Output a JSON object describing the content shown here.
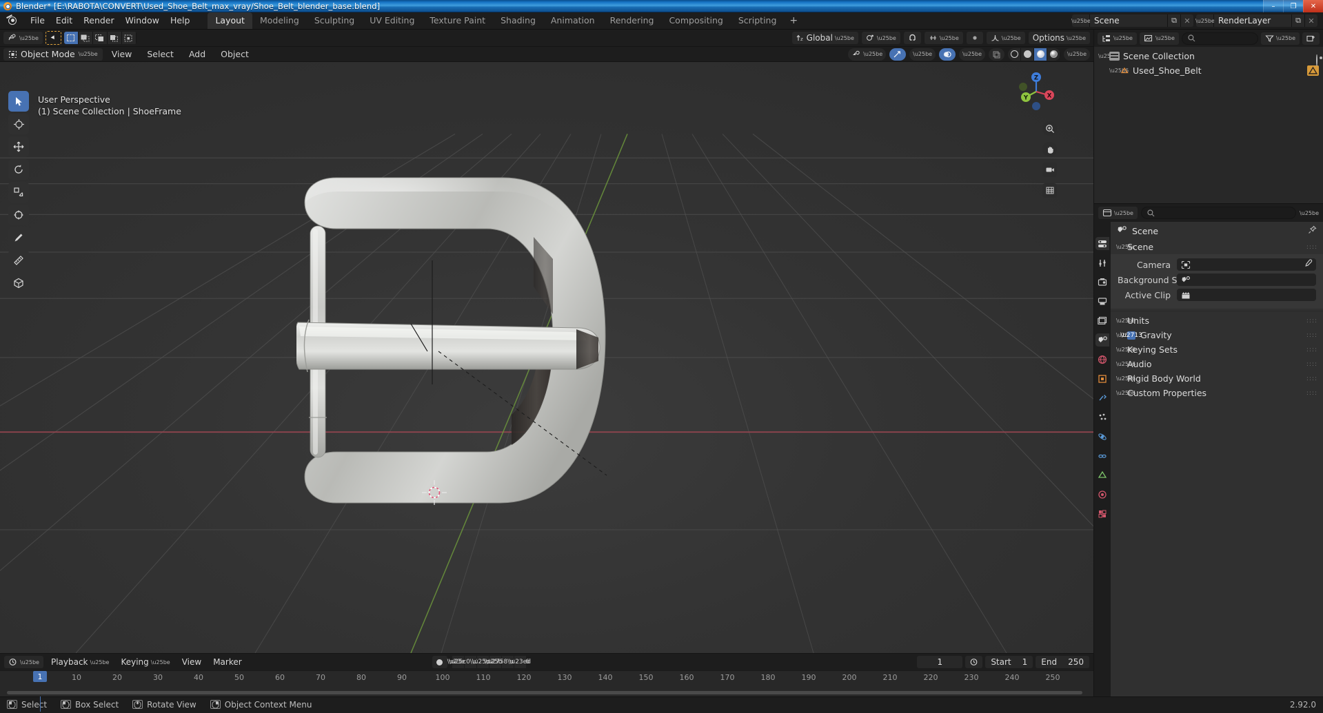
{
  "window": {
    "title": "Blender* [E:\\RABOTA\\CONVERT\\Used_Shoe_Belt_max_vray/Shoe_Belt_blender_base.blend]",
    "minimize": "–",
    "maximize": "❐",
    "close": "✕"
  },
  "topbar": {
    "menus": [
      "File",
      "Edit",
      "Render",
      "Window",
      "Help"
    ],
    "workspaces": [
      {
        "label": "Layout",
        "active": true
      },
      {
        "label": "Modeling",
        "active": false
      },
      {
        "label": "Sculpting",
        "active": false
      },
      {
        "label": "UV Editing",
        "active": false
      },
      {
        "label": "Texture Paint",
        "active": false
      },
      {
        "label": "Shading",
        "active": false
      },
      {
        "label": "Animation",
        "active": false
      },
      {
        "label": "Rendering",
        "active": false
      },
      {
        "label": "Compositing",
        "active": false
      },
      {
        "label": "Scripting",
        "active": false
      }
    ],
    "add_workspace": "+",
    "scene": {
      "name": "Scene",
      "dupe": "⧉",
      "unlink": "✕"
    },
    "view_layer": {
      "name": "RenderLayer",
      "dupe": "⧉",
      "unlink": "✕"
    }
  },
  "tool_header": {
    "editor_type": "editor-type-icon",
    "transform_orientation": "Global",
    "snap_label": "snap-magnet-icon",
    "proportional": "proportional-edit-icon",
    "options_label": "Options"
  },
  "viewport_header": {
    "mode": "Object Mode",
    "menus": [
      "View",
      "Select",
      "Add",
      "Object"
    ],
    "overlay_visibility": "show-hide-icon",
    "gizmo": "gizmo-icon",
    "overlays": "overlays-icon",
    "xray": "xray-icon",
    "shading_modes": [
      "wireframe",
      "solid",
      "material-preview",
      "rendered"
    ],
    "active_shading_index": 2
  },
  "viewport": {
    "perspective_label": "User Perspective",
    "collection_label": "(1) Scene Collection | ShoeFrame",
    "gizmo_axes": [
      {
        "name": "Z",
        "color": "#3e7ddb",
        "label": "Z"
      },
      {
        "name": "Y",
        "color": "#8fc33f",
        "label": "Y"
      },
      {
        "name": "X",
        "color": "#d9465a",
        "label": "X"
      }
    ],
    "nav_buttons": [
      "zoom-icon",
      "pan-hand-icon",
      "camera-icon",
      "ortho-persp-icon"
    ],
    "tools": [
      "tweak-select-tool",
      "cursor-tool",
      "move-tool",
      "rotate-tool",
      "scale-tool",
      "transform-tool",
      "annotate-tool",
      "measure-tool",
      "add-cube-tool"
    ],
    "active_tool_index": 0
  },
  "outliner": {
    "display_mode": "view-layer-icon",
    "filter_icon": "filter-icon",
    "new_collection_icon": "new-collection-icon",
    "search_placeholder": "",
    "rows": [
      {
        "label": "Scene Collection",
        "icon": "collection-icon",
        "indent": 0,
        "expanded": true
      },
      {
        "label": "Used_Shoe_Belt",
        "icon": "mesh-object-icon",
        "indent": 1,
        "expanded": false
      }
    ]
  },
  "properties": {
    "search_placeholder": "",
    "breadcrumb": "Scene",
    "breadcrumb_icon": "scene-props-icon",
    "pin_icon": "pin-icon",
    "tabs": [
      {
        "name": "tool-tab",
        "glyph": "⚙",
        "active": false
      },
      {
        "name": "render-tab",
        "glyph": "⌘",
        "active": false
      },
      {
        "name": "output-tab",
        "glyph": "⎙",
        "active": false
      },
      {
        "name": "view-layer-tab",
        "glyph": "❑",
        "active": false
      },
      {
        "name": "scene-tab",
        "glyph": "◐",
        "active": true
      },
      {
        "name": "world-tab",
        "glyph": "●",
        "active": false
      },
      {
        "name": "object-tab",
        "glyph": "▣",
        "active": false
      },
      {
        "name": "modifier-tab",
        "glyph": "⚒",
        "active": false
      },
      {
        "name": "particles-tab",
        "glyph": "⁂",
        "active": false
      },
      {
        "name": "physics-tab",
        "glyph": "◌",
        "active": false
      },
      {
        "name": "constraints-tab",
        "glyph": "⛓",
        "active": false
      },
      {
        "name": "data-tab",
        "glyph": "▽",
        "active": false
      },
      {
        "name": "material-tab",
        "glyph": "◉",
        "active": false
      },
      {
        "name": "texture-tab",
        "glyph": "▓",
        "active": false
      }
    ],
    "scene_panel": {
      "title": "Scene",
      "expanded": true,
      "fields": [
        {
          "label": "Camera",
          "value": "",
          "icon": "camera-data-icon",
          "has_dropper": true
        },
        {
          "label": "Background Scene",
          "value": "",
          "icon": "scene-icon",
          "has_dropper": false
        },
        {
          "label": "Active Clip",
          "value": "",
          "icon": "clip-icon",
          "has_dropper": false
        }
      ]
    },
    "panels": [
      {
        "title": "Units",
        "expanded": false,
        "checkbox": null
      },
      {
        "title": "Gravity",
        "expanded": false,
        "checkbox": true
      },
      {
        "title": "Keying Sets",
        "expanded": false,
        "checkbox": null
      },
      {
        "title": "Audio",
        "expanded": false,
        "checkbox": null
      },
      {
        "title": "Rigid Body World",
        "expanded": false,
        "checkbox": null
      },
      {
        "title": "Custom Properties",
        "expanded": false,
        "checkbox": null
      }
    ]
  },
  "timeline": {
    "editor_icon": "timeline-editor-icon",
    "menus": [
      "Playback",
      "Keying",
      "View",
      "Marker"
    ],
    "record_icon": "auto-keying-record-icon",
    "transport": [
      "jump-start",
      "prev-keyframe",
      "play-reverse",
      "play",
      "next-keyframe",
      "jump-end"
    ],
    "current_frame": "1",
    "start_label": "Start",
    "start_value": "1",
    "end_label": "End",
    "end_value": "250",
    "ticks": [
      10,
      20,
      30,
      40,
      50,
      60,
      70,
      80,
      90,
      100,
      110,
      120,
      130,
      140,
      150,
      160,
      170,
      180,
      190,
      200,
      210,
      220,
      230,
      240,
      250
    ],
    "playhead_frame": "1"
  },
  "statusbar": {
    "items": [
      {
        "icon": "mouse-left-icon",
        "label": "Select"
      },
      {
        "icon": "mouse-drag-icon",
        "label": "Box Select"
      },
      {
        "icon": "mouse-middle-icon",
        "label": "Rotate View"
      },
      {
        "icon": "mouse-right-icon",
        "label": "Object Context Menu"
      }
    ],
    "version": "2.92.0"
  }
}
